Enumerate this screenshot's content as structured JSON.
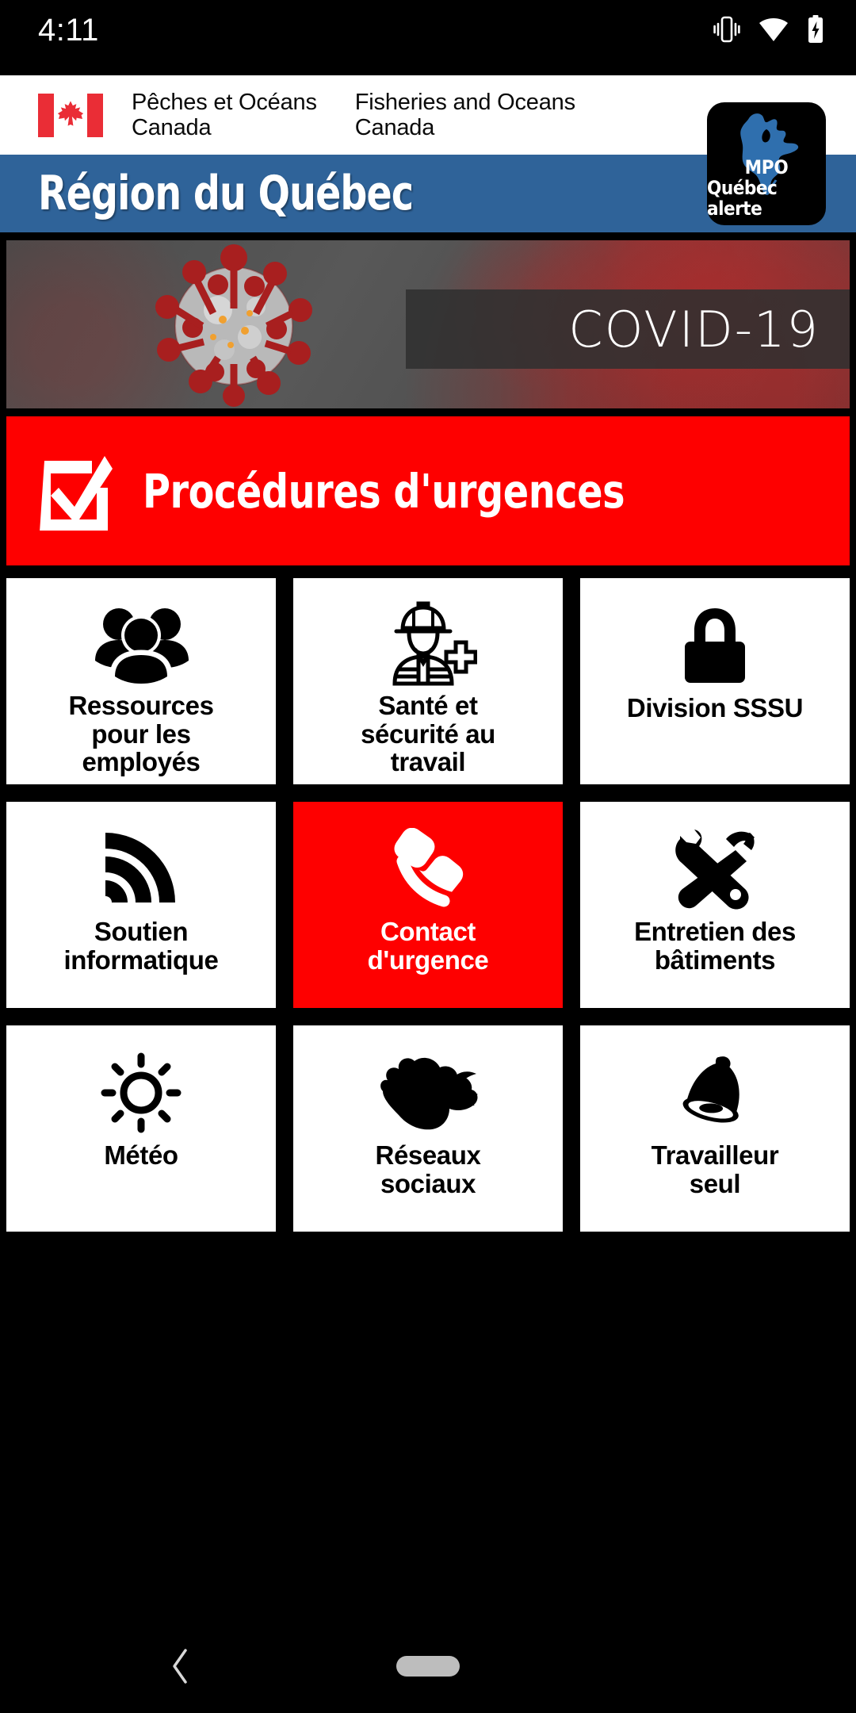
{
  "status_bar": {
    "time": "4:11",
    "icons": [
      "vibrate-icon",
      "wifi-icon",
      "battery-charging-icon"
    ]
  },
  "fip_header": {
    "flag_icon": "canada-flag-icon",
    "french_text": "Pêches et Océans\nCanada",
    "english_text": "Fisheries and Oceans\nCanada"
  },
  "app_badge": {
    "map_icon": "quebec-map-icon",
    "line1": "MPO",
    "line2": "Québec alerte",
    "colors": {
      "map": "#2f6fae",
      "background": "#000000"
    }
  },
  "title_banner": {
    "title": "Région du Québec",
    "background": "#2f6399"
  },
  "hero": {
    "icon": "coronavirus-icon",
    "label": "COVID-19"
  },
  "emergency_bar": {
    "icon": "checkbox-checked-icon",
    "label": "Procédures d'urgences",
    "background": "#fe0000"
  },
  "grid": {
    "tiles": [
      {
        "label": "Ressources\npour les\nemployés",
        "icon": "people-group-icon",
        "style": "white"
      },
      {
        "label": "Santé et\nsécurité au\ntravail",
        "icon": "worker-health-icon",
        "style": "white"
      },
      {
        "label": "Division SSSU",
        "icon": "padlock-icon",
        "style": "white"
      },
      {
        "label": "Soutien\ninformatique",
        "icon": "signal-waves-icon",
        "style": "white"
      },
      {
        "label": "Contact\nd'urgence",
        "icon": "phone-handset-icon",
        "style": "red"
      },
      {
        "label": "Entretien des\nbâtiments",
        "icon": "wrench-hammer-icon",
        "style": "white"
      },
      {
        "label": "Météo",
        "icon": "sun-icon",
        "style": "white"
      },
      {
        "label": "Réseaux\nsociaux",
        "icon": "twitter-bird-icon",
        "style": "white"
      },
      {
        "label": "Travailleur\nseul",
        "icon": "bell-icon",
        "style": "white"
      }
    ]
  },
  "nav_bar": {
    "back_icon": "back-chevron-icon",
    "home_icon": "home-pill-icon"
  }
}
